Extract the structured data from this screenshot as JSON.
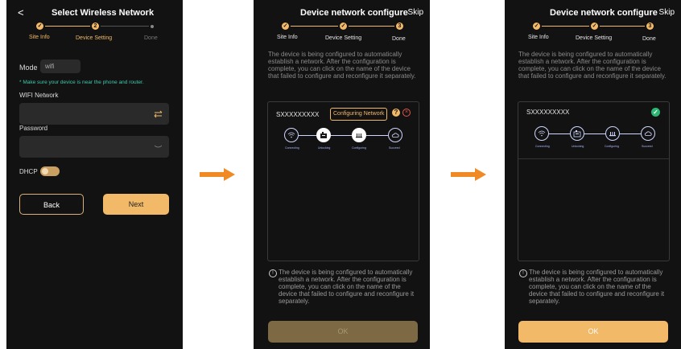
{
  "screen1": {
    "back_glyph": "<",
    "title": "Select Wireless Network",
    "steps": [
      "Site Info",
      "Device Setting",
      "Done"
    ],
    "step2_number": "2",
    "mode_label": "Mode",
    "mode_value": "wifi",
    "hint": "* Make sure your device is near the phone and router.",
    "wifi_label": "WIFI Network",
    "password_label": "Password",
    "dhcp_label": "DHCP",
    "back_button": "Back",
    "next_button": "Next"
  },
  "screen2": {
    "title": "Device network configure",
    "skip": "Skip",
    "steps": [
      "Site Info",
      "Device Setting",
      "Done"
    ],
    "step3_number": "3",
    "description": "The device is being configured to automatically establish a network. After the configuration is complete, you can click on the name of the device that failed to configure and reconfigure it separately.",
    "device_name": "SXXXXXXXXX",
    "status_badge": "Configuring Network",
    "nodes": [
      "Connecting",
      "Unlocking",
      "Configuring",
      "Succeed"
    ],
    "note": "The device is being configured to automatically establish a network. After the configuration is complete, you can click on the name of the device that failed to configure and reconfigure it separately.",
    "ok_button": "OK"
  },
  "screen3": {
    "title": "Device network configure",
    "skip": "Skip",
    "steps": [
      "Site Info",
      "Device Setting",
      "Done"
    ],
    "step3_number": "3",
    "description": "The device is being configured to automatically establish a network. After the configuration is complete, you can click on the name of the device that failed to configure and reconfigure it separately.",
    "device_name": "SXXXXXXXXX",
    "nodes": [
      "Connecting",
      "Unlocking",
      "Configuring",
      "Succeed"
    ],
    "note": "The device is being configured to automatically establish a network. After the configuration is complete, you can click on the name of the device that failed to configure and reconfigure it separately.",
    "ok_button": "OK"
  },
  "colors": {
    "accent": "#F2B968",
    "background": "#121212",
    "arrow": "#F08A24",
    "success": "#2BB673",
    "error": "#E2574C"
  }
}
